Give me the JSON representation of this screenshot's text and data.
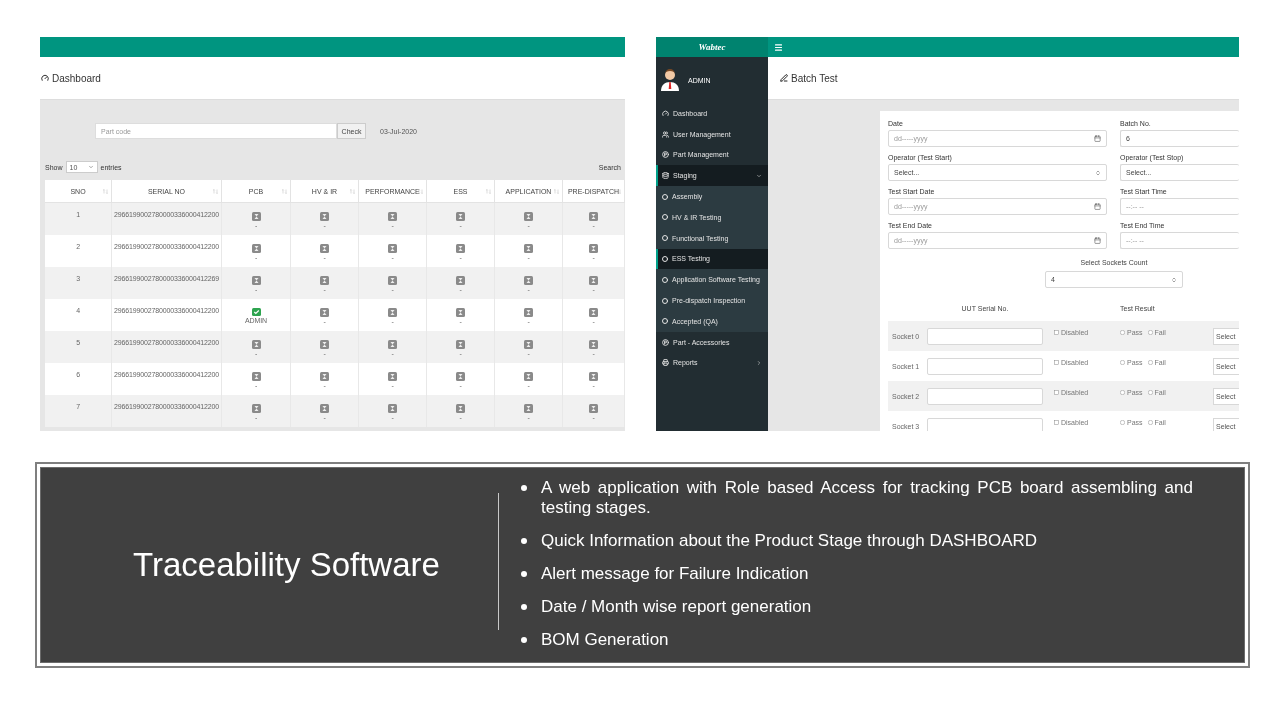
{
  "dashboard_screen": {
    "page_title": "Dashboard",
    "part_code": {
      "placeholder": "Part code"
    },
    "check_button": "Check",
    "date": "03-Jul-2020",
    "show_label": "Show",
    "entries_select": "10",
    "entries_label": "entries",
    "search_label": "Search",
    "columns": [
      "SNO",
      "SERIAL NO",
      "PCB",
      "HV & IR",
      "PERFORMANCE",
      "ESS",
      "APPLICATION",
      "PRE-DISPATCH"
    ],
    "rows": [
      {
        "sno": "1",
        "serial": "2966199002780000336000412200",
        "stages": [
          {
            "checked": false,
            "by": "-"
          },
          {
            "checked": false,
            "by": "-"
          },
          {
            "checked": false,
            "by": "-"
          },
          {
            "checked": false,
            "by": "-"
          },
          {
            "checked": false,
            "by": "-"
          },
          {
            "checked": false,
            "by": "-"
          }
        ]
      },
      {
        "sno": "2",
        "serial": "2966199002780000336000412200",
        "stages": [
          {
            "checked": false,
            "by": "-"
          },
          {
            "checked": false,
            "by": "-"
          },
          {
            "checked": false,
            "by": "-"
          },
          {
            "checked": false,
            "by": "-"
          },
          {
            "checked": false,
            "by": "-"
          },
          {
            "checked": false,
            "by": "-"
          }
        ]
      },
      {
        "sno": "3",
        "serial": "2966199002780000336000412269",
        "stages": [
          {
            "checked": false,
            "by": "-"
          },
          {
            "checked": false,
            "by": "-"
          },
          {
            "checked": false,
            "by": "-"
          },
          {
            "checked": false,
            "by": "-"
          },
          {
            "checked": false,
            "by": "-"
          },
          {
            "checked": false,
            "by": "-"
          }
        ]
      },
      {
        "sno": "4",
        "serial": "2966199002780000336000412200",
        "stages": [
          {
            "checked": true,
            "by": "ADMIN"
          },
          {
            "checked": false,
            "by": "-"
          },
          {
            "checked": false,
            "by": "-"
          },
          {
            "checked": false,
            "by": "-"
          },
          {
            "checked": false,
            "by": "-"
          },
          {
            "checked": false,
            "by": "-"
          }
        ]
      },
      {
        "sno": "5",
        "serial": "2966199002780000336000412200",
        "stages": [
          {
            "checked": false,
            "by": "-"
          },
          {
            "checked": false,
            "by": "-"
          },
          {
            "checked": false,
            "by": "-"
          },
          {
            "checked": false,
            "by": "-"
          },
          {
            "checked": false,
            "by": "-"
          },
          {
            "checked": false,
            "by": "-"
          }
        ]
      },
      {
        "sno": "6",
        "serial": "2966199002780000336000412200",
        "stages": [
          {
            "checked": false,
            "by": "-"
          },
          {
            "checked": false,
            "by": "-"
          },
          {
            "checked": false,
            "by": "-"
          },
          {
            "checked": false,
            "by": "-"
          },
          {
            "checked": false,
            "by": "-"
          },
          {
            "checked": false,
            "by": "-"
          }
        ]
      },
      {
        "sno": "7",
        "serial": "2966199002780000336000412200",
        "stages": [
          {
            "checked": false,
            "by": "-"
          },
          {
            "checked": false,
            "by": "-"
          },
          {
            "checked": false,
            "by": "-"
          },
          {
            "checked": false,
            "by": "-"
          },
          {
            "checked": false,
            "by": "-"
          },
          {
            "checked": false,
            "by": "-"
          }
        ]
      }
    ]
  },
  "batch_screen": {
    "logo": "Wabtec",
    "user": "ADMIN",
    "page_title": "Batch Test",
    "menu": [
      {
        "label": "Dashboard",
        "kind": "link",
        "selected": false
      },
      {
        "label": "User Management",
        "kind": "link",
        "selected": false
      },
      {
        "label": "Part Management",
        "kind": "link",
        "selected": false
      },
      {
        "label": "Staging",
        "kind": "group",
        "selected": true,
        "expanded": true,
        "children": [
          {
            "label": "Assembly",
            "selected": false
          },
          {
            "label": "HV & IR Testing",
            "selected": false
          },
          {
            "label": "Functional Testing",
            "selected": false
          },
          {
            "label": "ESS Testing",
            "selected": true
          },
          {
            "label": "Application Software Testing",
            "selected": false
          },
          {
            "label": "Pre-dispatch Inspection",
            "selected": false
          },
          {
            "label": "Accepted (QA)",
            "selected": false
          }
        ]
      },
      {
        "label": "Part - Accessories",
        "kind": "link",
        "selected": false
      },
      {
        "label": "Reports",
        "kind": "group",
        "selected": false,
        "expanded": false
      }
    ],
    "fields": [
      {
        "label": "Date",
        "kind": "date",
        "placeholder": "dd-----yyyy"
      },
      {
        "label": "Batch No.",
        "kind": "text",
        "value": "6"
      },
      {
        "label": "Operator (Test Start)",
        "kind": "select",
        "value": "Select..."
      },
      {
        "label": "Operator (Test Stop)",
        "kind": "select",
        "value": "Select..."
      },
      {
        "label": "Test Start Date",
        "kind": "date",
        "placeholder": "dd-----yyyy"
      },
      {
        "label": "Test Start Time",
        "kind": "time",
        "placeholder": "--:-- --"
      },
      {
        "label": "Test End Date",
        "kind": "date",
        "placeholder": "dd-----yyyy"
      },
      {
        "label": "Test End Time",
        "kind": "time",
        "placeholder": "--:-- --"
      }
    ],
    "sockets_count": {
      "label": "Select Sockets Count",
      "value": "4"
    },
    "socket_columns": [
      "UUT Serial No.",
      "Test Result"
    ],
    "sockets": [
      {
        "label": "Socket 0",
        "disabled_label": "Disabled",
        "disabled": false,
        "results": [
          {
            "label": "Pass",
            "selected": false
          },
          {
            "label": "Fail",
            "selected": false
          }
        ],
        "select": "Select"
      },
      {
        "label": "Socket 1",
        "disabled_label": "Disabled",
        "disabled": false,
        "results": [
          {
            "label": "Pass",
            "selected": false
          },
          {
            "label": "Fail",
            "selected": false
          }
        ],
        "select": "Select"
      },
      {
        "label": "Socket 2",
        "disabled_label": "Disabled",
        "disabled": false,
        "results": [
          {
            "label": "Pass",
            "selected": false
          },
          {
            "label": "Fail",
            "selected": false
          }
        ],
        "select": "Select"
      },
      {
        "label": "Socket 3",
        "disabled_label": "Disabled",
        "disabled": false,
        "results": [
          {
            "label": "Pass",
            "selected": false
          },
          {
            "label": "Fail",
            "selected": false
          }
        ],
        "select": "Select"
      }
    ]
  },
  "slide": {
    "title": "Traceability Software",
    "bullets": [
      "A web application with Role based Access for tracking PCB board assembling and testing stages.",
      "Quick Information about the Product Stage through DASHBOARD",
      "Alert message for Failure Indication",
      "Date / Month wise report generation",
      "BOM Generation"
    ]
  }
}
